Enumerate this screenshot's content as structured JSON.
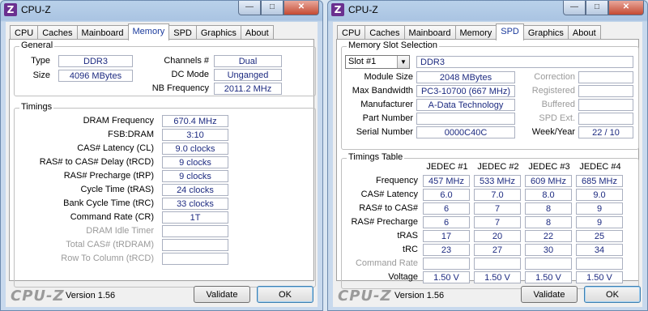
{
  "left_window": {
    "title": "CPU-Z",
    "app_icon": "Z",
    "tabs": [
      "CPU",
      "Caches",
      "Mainboard",
      "Memory",
      "SPD",
      "Graphics",
      "About"
    ],
    "active_tab": "Memory",
    "general": {
      "title": "General",
      "type_label": "Type",
      "type_value": "DDR3",
      "size_label": "Size",
      "size_value": "4096 MBytes",
      "channels_label": "Channels #",
      "channels_value": "Dual",
      "dcmode_label": "DC Mode",
      "dcmode_value": "Unganged",
      "nbfreq_label": "NB Frequency",
      "nbfreq_value": "2011.2 MHz"
    },
    "timings": {
      "title": "Timings",
      "rows": [
        {
          "label": "DRAM Frequency",
          "value": "670.4 MHz"
        },
        {
          "label": "FSB:DRAM",
          "value": "3:10"
        },
        {
          "label": "CAS# Latency (CL)",
          "value": "9.0 clocks"
        },
        {
          "label": "RAS# to CAS# Delay (tRCD)",
          "value": "9 clocks"
        },
        {
          "label": "RAS# Precharge (tRP)",
          "value": "9 clocks"
        },
        {
          "label": "Cycle Time (tRAS)",
          "value": "24 clocks"
        },
        {
          "label": "Bank Cycle Time (tRC)",
          "value": "33 clocks"
        },
        {
          "label": "Command Rate (CR)",
          "value": "1T"
        },
        {
          "label": "DRAM Idle Timer",
          "value": ""
        },
        {
          "label": "Total CAS# (tRDRAM)",
          "value": ""
        },
        {
          "label": "Row To Column (tRCD)",
          "value": ""
        }
      ]
    },
    "logo": "CPU-Z",
    "version": "Version 1.56",
    "validate_label": "Validate",
    "ok_label": "OK"
  },
  "right_window": {
    "title": "CPU-Z",
    "app_icon": "Z",
    "tabs": [
      "CPU",
      "Caches",
      "Mainboard",
      "Memory",
      "SPD",
      "Graphics",
      "About"
    ],
    "active_tab": "SPD",
    "slot": {
      "title": "Memory Slot Selection",
      "selected": "Slot #1",
      "type_value": "DDR3",
      "module_size_label": "Module Size",
      "module_size_value": "2048 MBytes",
      "max_bw_label": "Max Bandwidth",
      "max_bw_value": "PC3-10700 (667 MHz)",
      "manufacturer_label": "Manufacturer",
      "manufacturer_value": "A-Data Technology",
      "part_label": "Part Number",
      "part_value": "",
      "serial_label": "Serial Number",
      "serial_value": "0000C40C",
      "correction_label": "Correction",
      "registered_label": "Registered",
      "buffered_label": "Buffered",
      "spdext_label": "SPD Ext.",
      "weekyear_label": "Week/Year",
      "weekyear_value": "22 / 10"
    },
    "timings_table": {
      "title": "Timings Table",
      "columns": [
        "JEDEC #1",
        "JEDEC #2",
        "JEDEC #3",
        "JEDEC #4"
      ],
      "rows": [
        {
          "label": "Frequency",
          "values": [
            "457 MHz",
            "533 MHz",
            "609 MHz",
            "685 MHz"
          ],
          "gray": false
        },
        {
          "label": "CAS# Latency",
          "values": [
            "6.0",
            "7.0",
            "8.0",
            "9.0"
          ],
          "gray": false
        },
        {
          "label": "RAS# to CAS#",
          "values": [
            "6",
            "7",
            "8",
            "9"
          ],
          "gray": false
        },
        {
          "label": "RAS# Precharge",
          "values": [
            "6",
            "7",
            "8",
            "9"
          ],
          "gray": false
        },
        {
          "label": "tRAS",
          "values": [
            "17",
            "20",
            "22",
            "25"
          ],
          "gray": false
        },
        {
          "label": "tRC",
          "values": [
            "23",
            "27",
            "30",
            "34"
          ],
          "gray": false
        },
        {
          "label": "Command Rate",
          "values": [
            "",
            "",
            "",
            ""
          ],
          "gray": true
        },
        {
          "label": "Voltage",
          "values": [
            "1.50 V",
            "1.50 V",
            "1.50 V",
            "1.50 V"
          ],
          "gray": false
        }
      ]
    },
    "logo": "CPU-Z",
    "version": "Version 1.56",
    "validate_label": "Validate",
    "ok_label": "OK"
  }
}
